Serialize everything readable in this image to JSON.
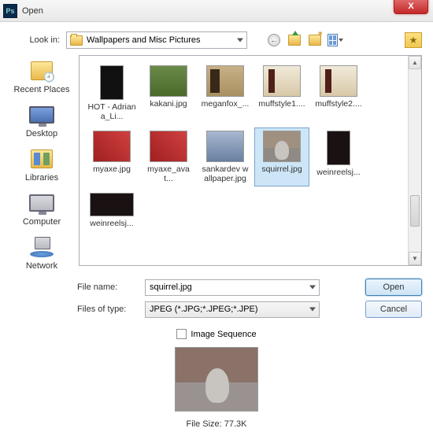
{
  "titlebar": {
    "title": "Open",
    "close_glyph": "X"
  },
  "lookin": {
    "label": "Look in:",
    "value": "Wallpapers and Misc Pictures"
  },
  "places": {
    "recent": "Recent Places",
    "desktop": "Desktop",
    "libraries": "Libraries",
    "computer": "Computer",
    "network": "Network"
  },
  "files": [
    {
      "name": "HOT - Adriana_Li..."
    },
    {
      "name": "kakani.jpg"
    },
    {
      "name": "meganfox_..."
    },
    {
      "name": "muffstyle1...."
    },
    {
      "name": "muffstyle2...."
    },
    {
      "name": "myaxe.jpg"
    },
    {
      "name": "myaxe_avat..."
    },
    {
      "name": "sankardev wallpaper.jpg"
    },
    {
      "name": "squirrel.jpg"
    },
    {
      "name": "weinreelsj..."
    },
    {
      "name": "weinreelsj..."
    }
  ],
  "form": {
    "filename_label": "File name:",
    "filename_value": "squirrel.jpg",
    "filetype_label": "Files of type:",
    "filetype_value": "JPEG (*.JPG;*.JPEG;*.JPE)",
    "open": "Open",
    "cancel": "Cancel",
    "sequence": "Image Sequence"
  },
  "preview": {
    "filesize": "File Size: 77.3K"
  }
}
